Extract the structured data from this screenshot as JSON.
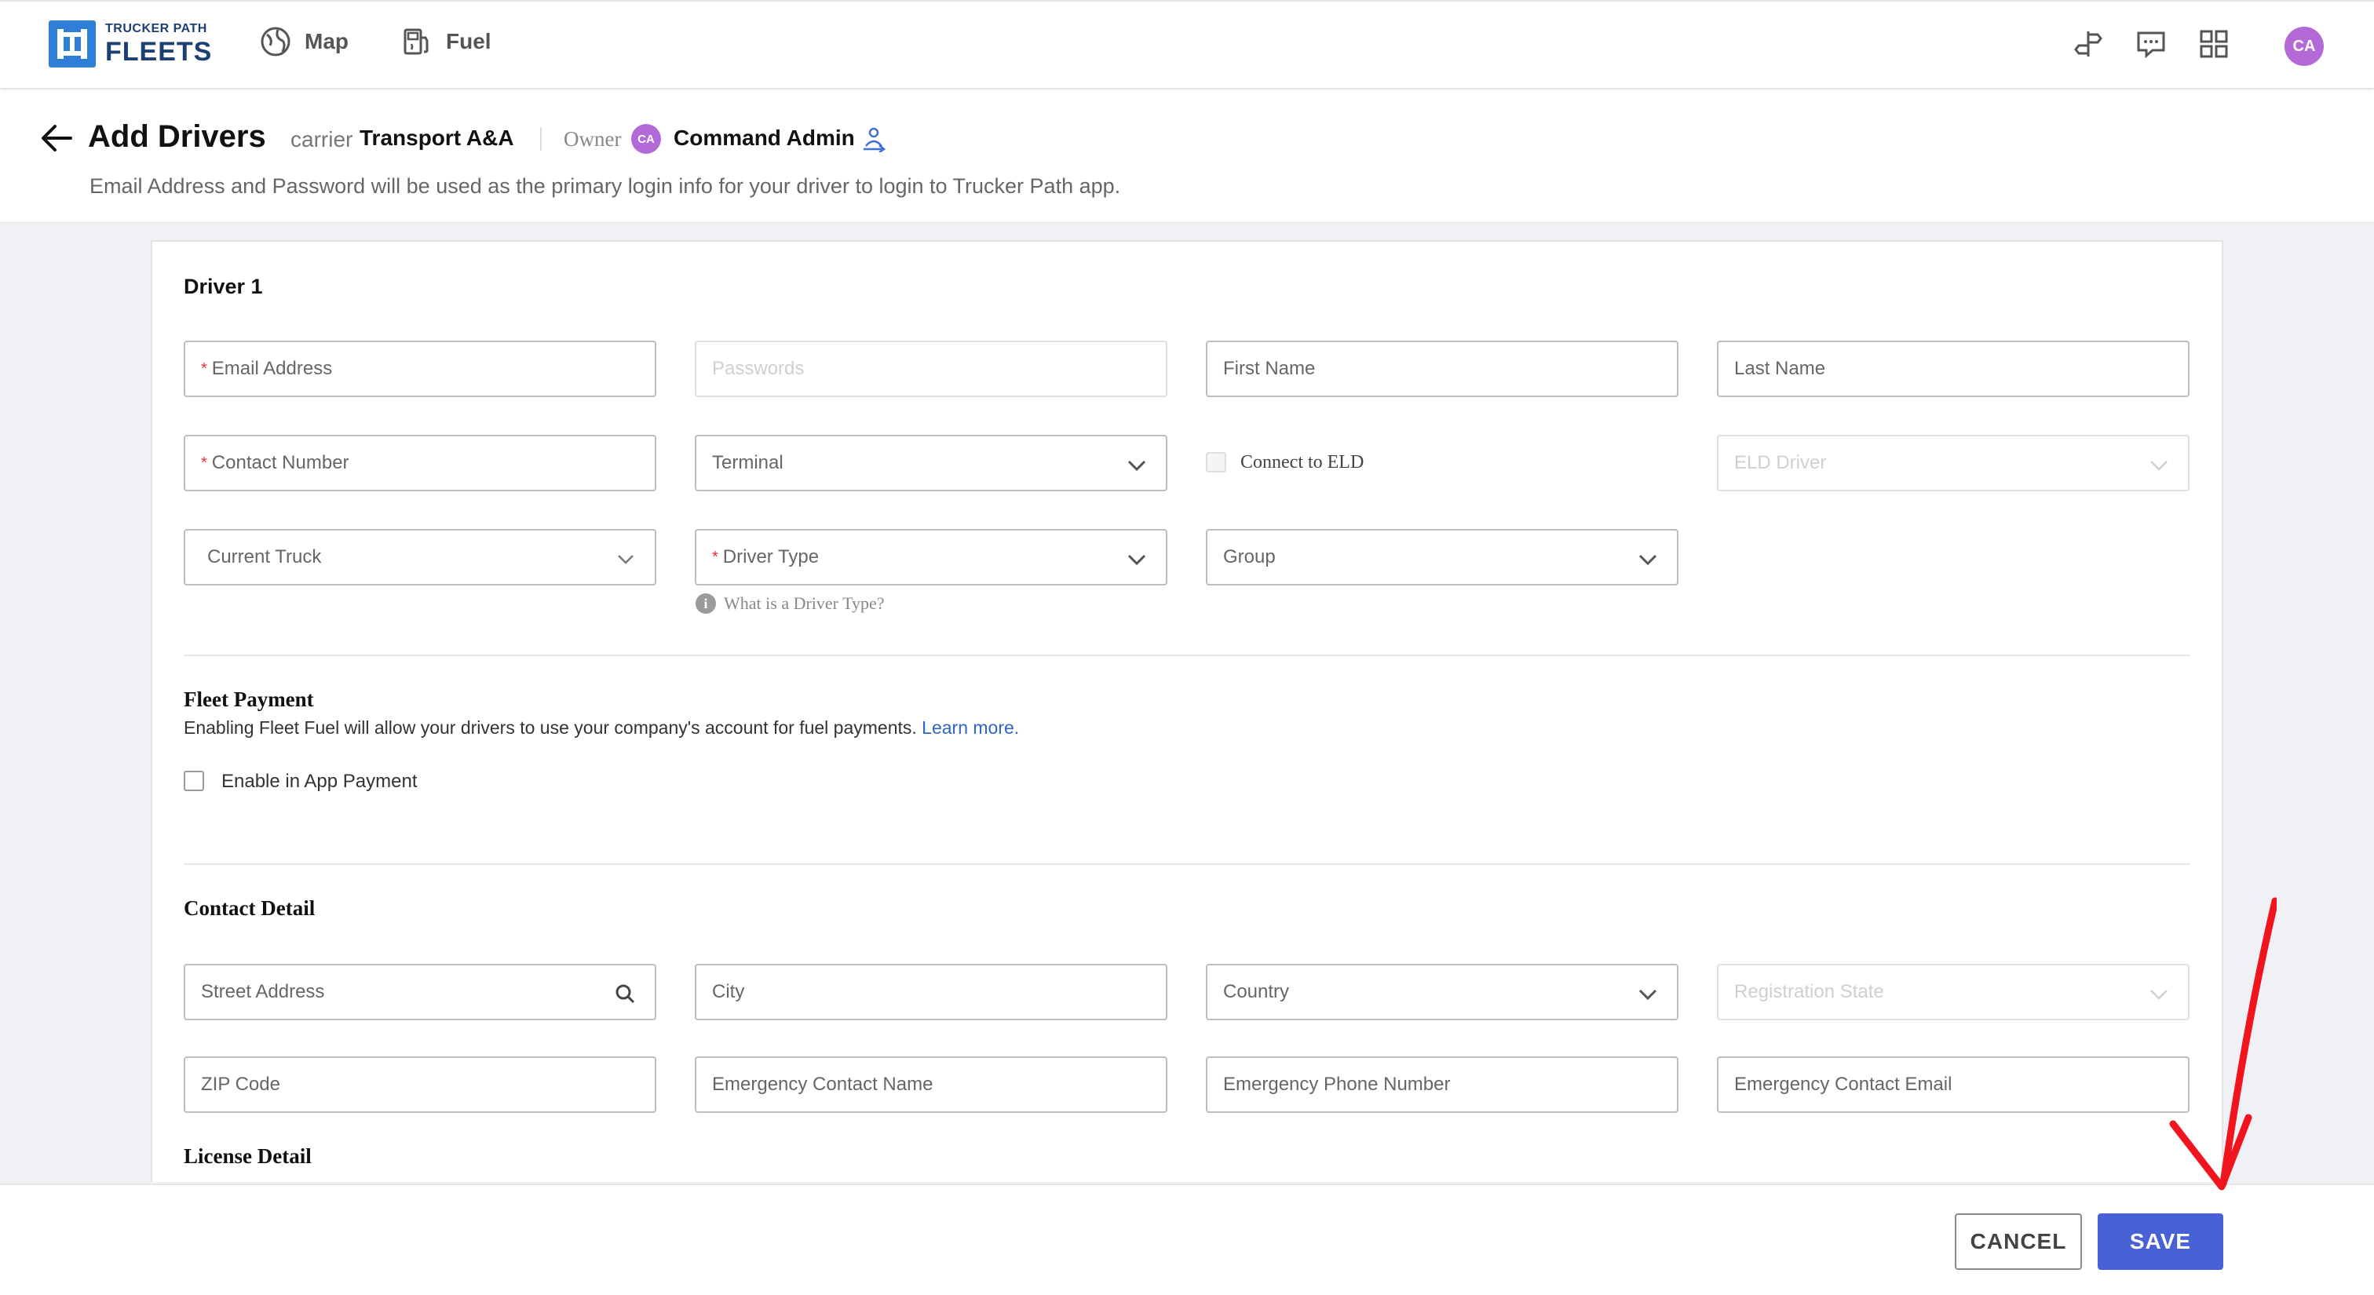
{
  "nav": {
    "brand_small": "TRUCKER PATH",
    "brand_big": "FLEETS",
    "map_label": "Map",
    "fuel_label": "Fuel",
    "user_initials": "CA"
  },
  "header": {
    "title": "Add Drivers",
    "carrier_label": "carrier",
    "carrier_name": "Transport A&A",
    "owner_label": "Owner",
    "owner_initials": "CA",
    "owner_name": "Command Admin",
    "subtitle": "Email Address and Password will be used as the primary login info for your driver to login to Trucker Path app."
  },
  "driver": {
    "title": "Driver 1",
    "email": "Email Address",
    "password": "Passwords",
    "first_name": "First Name",
    "last_name": "Last Name",
    "contact_number": "Contact Number",
    "terminal": "Terminal",
    "connect_eld": "Connect to ELD",
    "eld_driver": "ELD Driver",
    "current_truck": "Current Truck",
    "driver_type": "Driver Type",
    "group": "Group",
    "driver_type_help": "What is a Driver Type?",
    "required_mark": "*"
  },
  "payment": {
    "title": "Fleet Payment",
    "description": "Enabling Fleet Fuel will allow your drivers to use your company's account for fuel payments.",
    "learn_more": "Learn more.",
    "enable_label": "Enable in App Payment"
  },
  "contact": {
    "title": "Contact Detail",
    "street": "Street Address",
    "city": "City",
    "country": "Country",
    "registration_state": "Registration State",
    "zip": "ZIP Code",
    "emergency_name": "Emergency Contact Name",
    "emergency_phone": "Emergency Phone Number",
    "emergency_email": "Emergency Contact Email"
  },
  "license": {
    "title": "License Detail"
  },
  "footer": {
    "cancel_label": "CANCEL",
    "save_label": "SAVE"
  },
  "colors": {
    "primary": "#4862d6",
    "avatar": "#b36ad6",
    "brand": "#2f7fd8",
    "annotation_arrow": "#f0141e"
  },
  "icons": [
    "logo-icon",
    "map-icon",
    "fuel-icon",
    "route-icon",
    "chat-icon",
    "apps-grid-icon",
    "back-arrow-icon",
    "switch-owner-icon",
    "chevron-down-icon",
    "search-icon",
    "info-icon"
  ]
}
